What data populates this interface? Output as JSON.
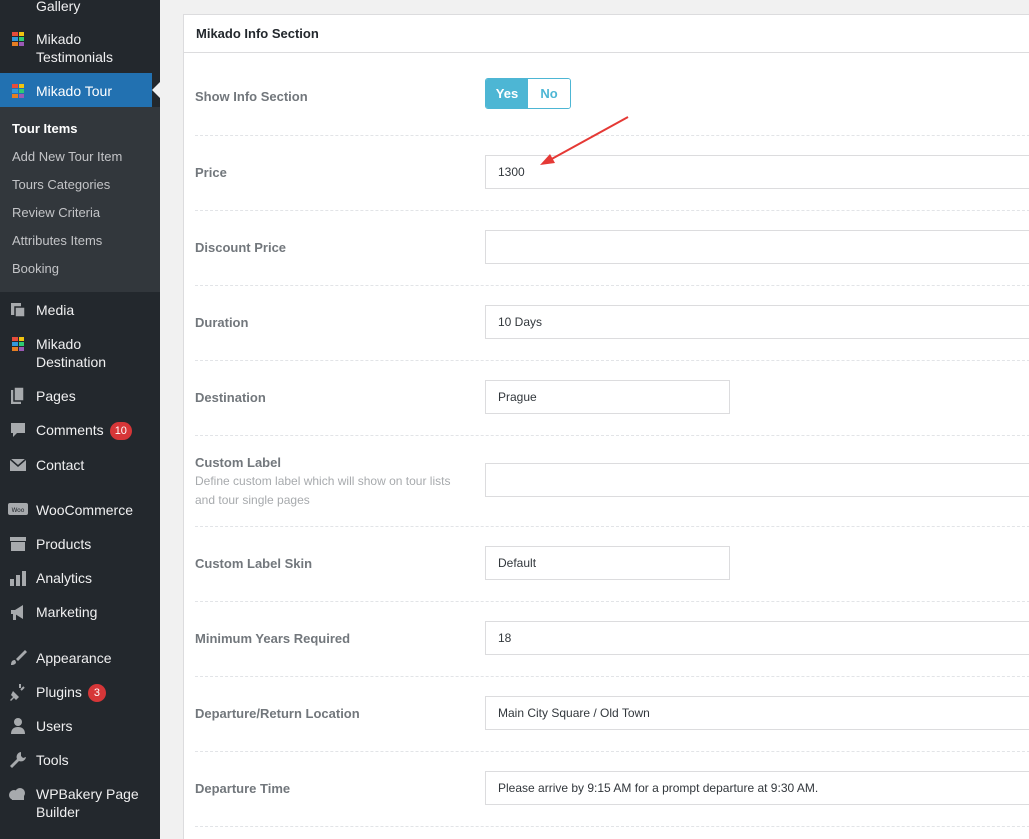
{
  "sidebar": {
    "items": {
      "gallery": "Gallery",
      "testimonials": "Mikado Testimonials",
      "tour": "Mikado Tour",
      "media": "Media",
      "destination": "Mikado Destination",
      "pages": "Pages",
      "comments": "Comments",
      "comments_badge": "10",
      "contact": "Contact",
      "woocommerce": "WooCommerce",
      "products": "Products",
      "analytics": "Analytics",
      "marketing": "Marketing",
      "appearance": "Appearance",
      "plugins": "Plugins",
      "plugins_badge": "3",
      "users": "Users",
      "tools": "Tools",
      "wpbakery": "WPBakery Page Builder"
    },
    "submenu": [
      "Tour Items",
      "Add New Tour Item",
      "Tours Categories",
      "Review Criteria",
      "Attributes Items",
      "Booking"
    ],
    "colors": {
      "bg": "#23282d",
      "active": "#2271b1",
      "submenu_bg": "#32373c"
    }
  },
  "panel": {
    "title": "Mikado Info Section",
    "show_info": {
      "label": "Show Info Section",
      "yes": "Yes",
      "no": "No",
      "selected": "Yes"
    },
    "price": {
      "label": "Price",
      "value": "1300"
    },
    "discount_price": {
      "label": "Discount Price",
      "value": ""
    },
    "duration": {
      "label": "Duration",
      "value": "10 Days"
    },
    "destination": {
      "label": "Destination",
      "value": "Prague"
    },
    "custom_label": {
      "label": "Custom Label",
      "description": "Define custom label which will show on tour lists and tour single pages",
      "value": ""
    },
    "custom_label_skin": {
      "label": "Custom Label Skin",
      "value": "Default"
    },
    "min_years": {
      "label": "Minimum Years Required",
      "value": "18"
    },
    "departure_location": {
      "label": "Departure/Return Location",
      "value": "Main City Square / Old Town"
    },
    "departure_time": {
      "label": "Departure Time",
      "value": "Please arrive by 9:15 AM for a prompt departure at 9:30 AM."
    }
  },
  "colors": {
    "accent": "#4db6d4",
    "annotation_arrow": "#e53935"
  }
}
